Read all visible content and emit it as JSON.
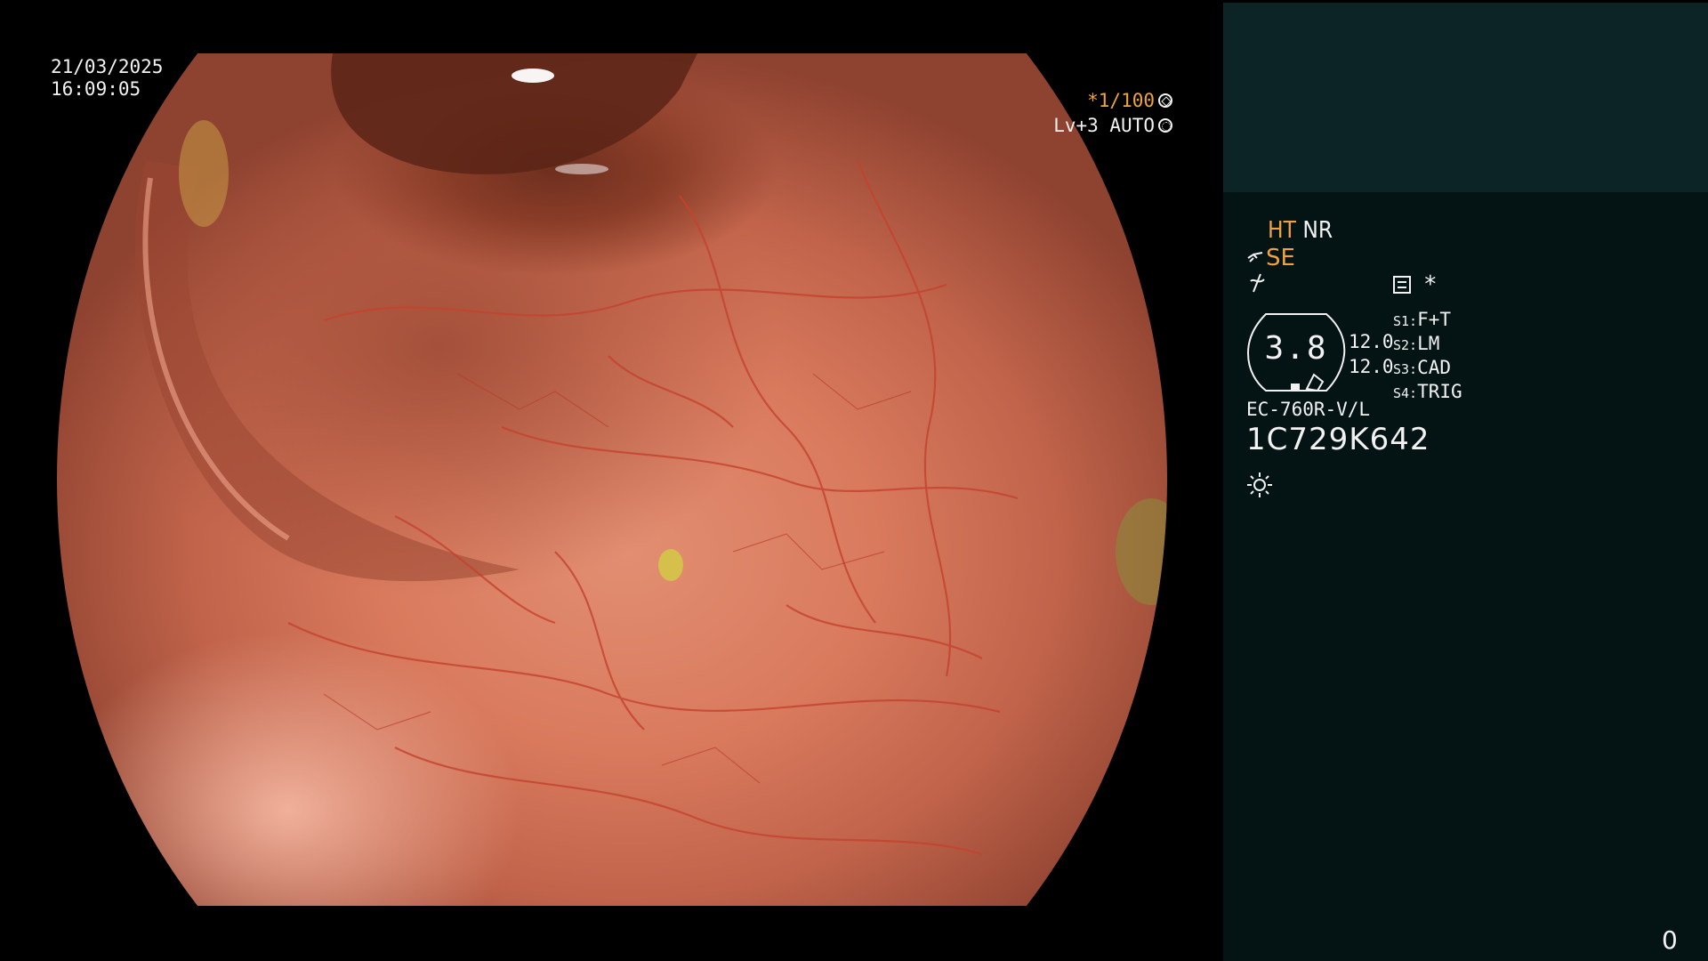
{
  "timestamp": {
    "date": "21/03/2025",
    "time": "16:09:05"
  },
  "shutter": {
    "speed_prefix": "*1/100",
    "level": "Lv+3 AUTO"
  },
  "enhancement": {
    "ht": "HT",
    "nr": "NR",
    "se": "SE"
  },
  "status_mark": "*",
  "gauge": {
    "value": "3.8",
    "side_top": "12.0",
    "side_bottom": "12.0"
  },
  "switches": [
    {
      "key": "S1:",
      "value": "F+T"
    },
    {
      "key": "S2:",
      "value": "LM"
    },
    {
      "key": "S3:",
      "value": "CAD"
    },
    {
      "key": "S4:",
      "value": "TRIG"
    }
  ],
  "scope": {
    "model": "EC-760R-V/L",
    "serial": "1C729K642"
  },
  "counter": "0",
  "colors": {
    "accent": "#f1a23c",
    "panel_top": "#0d2426",
    "panel_bottom": "#041313",
    "text": "#f2f2f2"
  },
  "icons": [
    "aperture-icon",
    "auto-exposure-icon",
    "pen-icon",
    "freeze-icon",
    "memo-icon",
    "gauge-icon",
    "light-source-icon"
  ]
}
